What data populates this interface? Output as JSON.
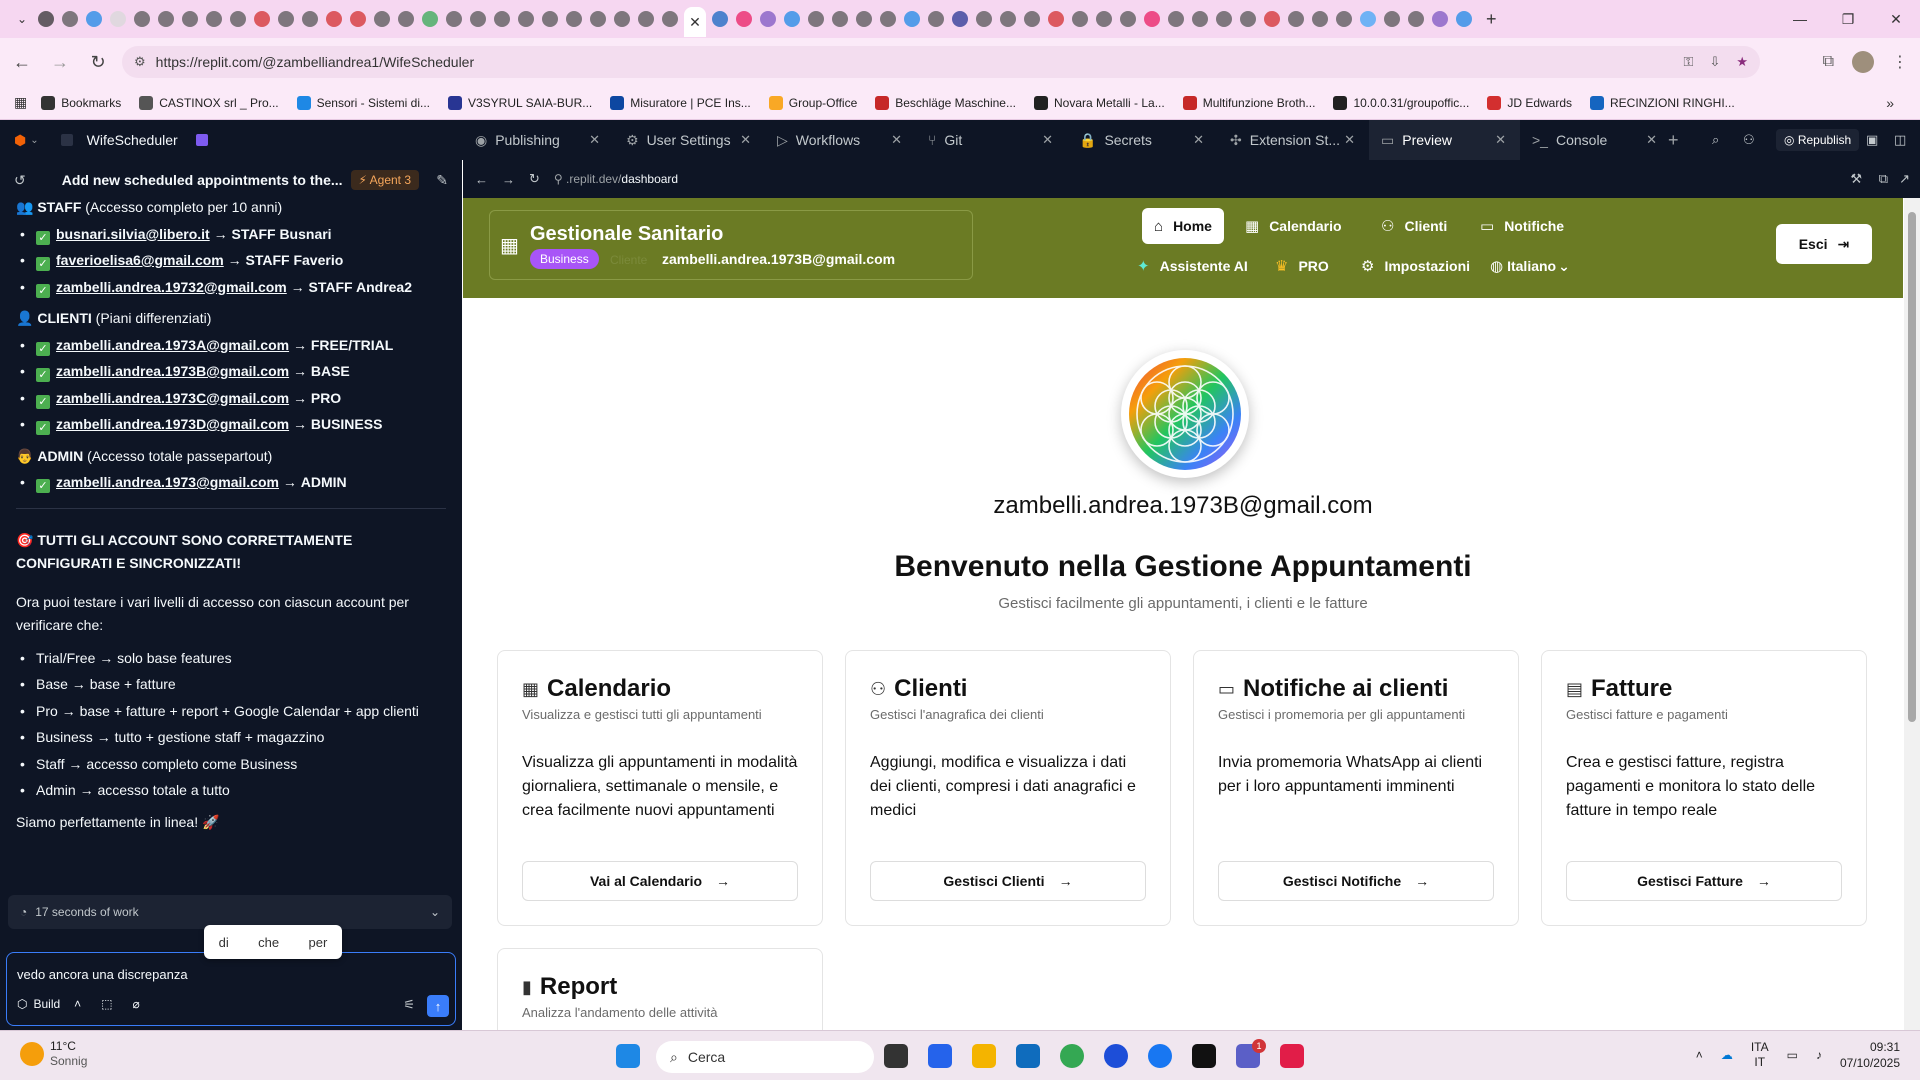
{
  "browser": {
    "url": "https://replit.com/@zambelliandrea1/WifeScheduler",
    "active_tab_close": "✕",
    "bookmarks": [
      {
        "label": "Bookmarks",
        "color": "#333333"
      },
      {
        "label": "CASTINOX srl _ Pro...",
        "color": "#555555"
      },
      {
        "label": "Sensori - Sistemi di...",
        "color": "#1e88e5"
      },
      {
        "label": "V3SYRUL SAIA-BUR...",
        "color": "#283593"
      },
      {
        "label": "Misuratore | PCE Ins...",
        "color": "#0d47a1"
      },
      {
        "label": "Group-Office",
        "color": "#f9a825"
      },
      {
        "label": "Beschläge Maschine...",
        "color": "#c62828"
      },
      {
        "label": "Novara Metalli - La...",
        "color": "#212121"
      },
      {
        "label": "Multifunzione Broth...",
        "color": "#c62828"
      },
      {
        "label": "10.0.0.31/groupoffic...",
        "color": "#212121"
      },
      {
        "label": "JD Edwards",
        "color": "#d32f2f"
      },
      {
        "label": "RECINZIONI RINGHI...",
        "color": "#1565c0"
      }
    ]
  },
  "replit": {
    "project": "WifeScheduler",
    "tabs": [
      {
        "label": "Publishing",
        "icon": "publishing-icon"
      },
      {
        "label": "User Settings",
        "icon": "gear-icon"
      },
      {
        "label": "Workflows",
        "icon": "play-icon"
      },
      {
        "label": "Git",
        "icon": "git-icon"
      },
      {
        "label": "Secrets",
        "icon": "lock-icon"
      },
      {
        "label": "Extension St...",
        "icon": "puzzle-icon"
      },
      {
        "label": "Preview",
        "icon": "preview-icon"
      },
      {
        "label": "Console",
        "icon": "console-icon"
      }
    ],
    "republish": "Republish"
  },
  "chat": {
    "title": "Add new scheduled appointments to the...",
    "agent": "Agent 3",
    "staff_header_b": "STAFF",
    "staff_header_rest": " (Accesso completo per 10 anni)",
    "staff": [
      {
        "email": "busnari.silvia@libero.it",
        "role": "STAFF Busnari"
      },
      {
        "email": "faverioelisa6@gmail.com",
        "role": "STAFF Faverio"
      },
      {
        "email": "zambelli.andrea.19732@gmail.com",
        "role": "STAFF Andrea2"
      }
    ],
    "clients_header_b": "CLIENTI",
    "clients_header_rest": " (Piani differenziati)",
    "clients": [
      {
        "email": "zambelli.andrea.1973A@gmail.com",
        "role": "FREE/TRIAL"
      },
      {
        "email": "zambelli.andrea.1973B@gmail.com",
        "role": "BASE"
      },
      {
        "email": "zambelli.andrea.1973C@gmail.com",
        "role": "PRO"
      },
      {
        "email": "zambelli.andrea.1973D@gmail.com",
        "role": "BUSINESS"
      }
    ],
    "admin_header_b": "ADMIN",
    "admin_header_rest": " (Accesso totale passepartout)",
    "admin": [
      {
        "email": "zambelli.andrea.1973@gmail.com",
        "role": "ADMIN"
      }
    ],
    "configured": "TUTTI GLI ACCOUNT SONO CORRETTAMENTE CONFIGURATI E SINCRONIZZATI!",
    "intro": "Ora puoi testare i vari livelli di accesso con ciascun account per verificare che:",
    "levels": [
      "Trial/Free → solo base features",
      "Base → base + fatture",
      "Pro → base + fatture + report + Google Calendar + app clienti",
      "Business → tutto + gestione staff + magazzino",
      "Staff → accesso completo come Business",
      "Admin → accesso totale a tutto"
    ],
    "closing": "Siamo perfettamente in linea! 🚀",
    "work": "17 seconds of work",
    "suggestions": [
      "di",
      "che",
      "per"
    ],
    "input_value": "vedo ancora una discrepanza",
    "build": "Build"
  },
  "preview": {
    "url_prefix": ".replit.dev/",
    "url_path": "dashboard",
    "brand_title": "Gestionale Sanitario",
    "badge": "Business",
    "faded_label": "Cliente",
    "email": "zambelli.andrea.1973B@gmail.com",
    "nav": [
      "Home",
      "Calendario",
      "Clienti",
      "Notifiche",
      "Assistente AI",
      "PRO",
      "Impostazioni",
      "Italiano"
    ],
    "logout": "Esci",
    "hero_email": "zambelli.andrea.1973B@gmail.com",
    "hero_title": "Benvenuto nella Gestione Appuntamenti",
    "hero_sub": "Gestisci facilmente gli appuntamenti, i clienti e le fatture",
    "cards": [
      {
        "title": "Calendario",
        "sub": "Visualizza e gestisci tutti gli appuntamenti",
        "desc": "Visualizza gli appuntamenti in modalità giornaliera, settimanale o mensile, e crea facilmente nuovi appuntamenti",
        "btn": "Vai al Calendario"
      },
      {
        "title": "Clienti",
        "sub": "Gestisci l'anagrafica dei clienti",
        "desc": "Aggiungi, modifica e visualizza i dati dei clienti, compresi i dati anagrafici e medici",
        "btn": "Gestisci Clienti"
      },
      {
        "title": "Notifiche ai clienti",
        "sub": "Gestisci i promemoria per gli appuntamenti",
        "desc": "Invia promemoria WhatsApp ai clienti per i loro appuntamenti imminenti",
        "btn": "Gestisci Notifiche"
      },
      {
        "title": "Fatture",
        "sub": "Gestisci fatture e pagamenti",
        "desc": "Crea e gestisci fatture, registra pagamenti e monitora lo stato delle fatture in tempo reale",
        "btn": "Gestisci Fatture"
      },
      {
        "title": "Report",
        "sub": "Analizza l'andamento delle attività",
        "desc": "",
        "btn": ""
      }
    ],
    "header_color": "#6b7b24"
  },
  "taskbar": {
    "temp": "11°C",
    "weather": "Sonnig",
    "search": "Cerca",
    "lang1": "ITA",
    "lang2": "IT",
    "time": "09:31",
    "date": "07/10/2025",
    "notif_count": "1"
  }
}
